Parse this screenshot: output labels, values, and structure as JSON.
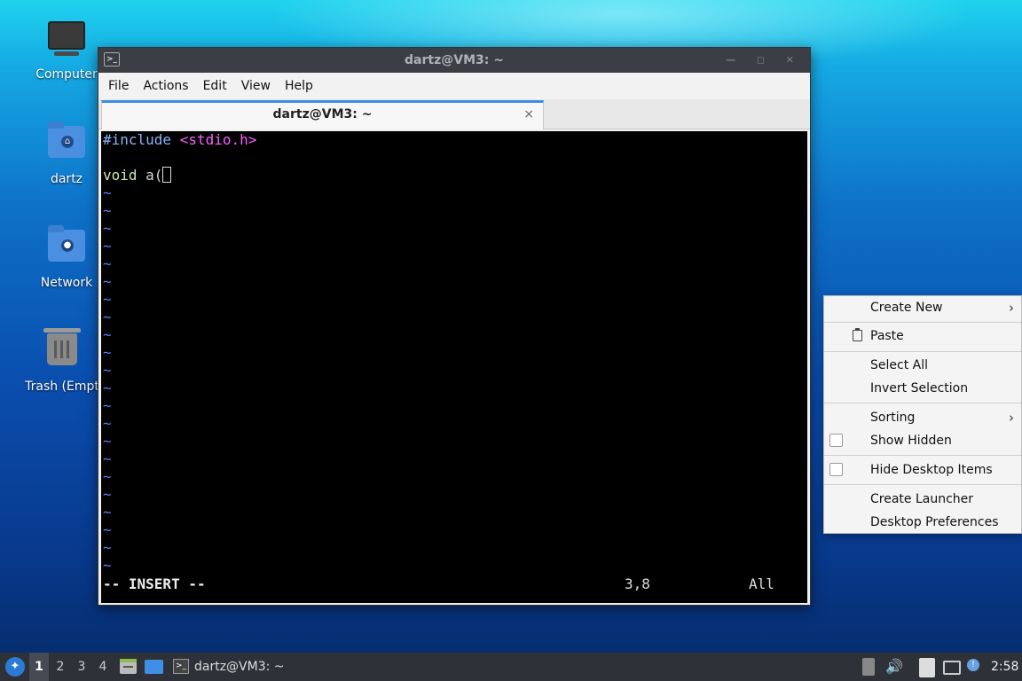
{
  "desktop": {
    "icons": [
      {
        "label": "Computer"
      },
      {
        "label": "dartz"
      },
      {
        "label": "Network"
      },
      {
        "label": "Trash (Empt"
      }
    ]
  },
  "window": {
    "title": "dartz@VM3: ~",
    "menu": [
      "File",
      "Actions",
      "Edit",
      "View",
      "Help"
    ],
    "tab_title": "dartz@VM3: ~",
    "tab_close": "×",
    "editor": {
      "line1_hash": "#include",
      "line1_header": "<stdio.h>",
      "line3_type": "void",
      "line3_rest": " a(",
      "tilde": "~",
      "mode": "-- INSERT --",
      "position": "3,8",
      "scroll": "All"
    }
  },
  "context_menu": {
    "create_new": "Create New",
    "paste": "Paste",
    "select_all": "Select All",
    "invert_selection": "Invert Selection",
    "sorting": "Sorting",
    "show_hidden": "Show Hidden",
    "hide_desktop_items": "Hide Desktop Items",
    "create_launcher": "Create Launcher",
    "desktop_preferences": "Desktop Preferences",
    "submenu_arrow": "›"
  },
  "taskbar": {
    "workspaces": [
      "1",
      "2",
      "3",
      "4"
    ],
    "task_label": "dartz@VM3: ~",
    "clock": "2:58"
  }
}
